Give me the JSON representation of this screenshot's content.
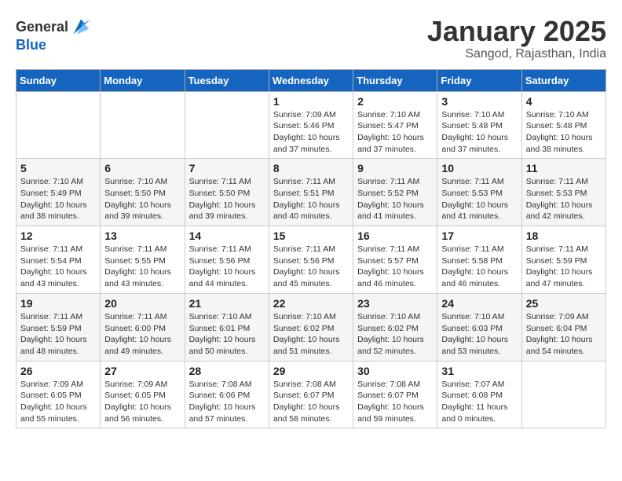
{
  "header": {
    "logo_general": "General",
    "logo_blue": "Blue",
    "month": "January 2025",
    "location": "Sangod, Rajasthan, India"
  },
  "days_of_week": [
    "Sunday",
    "Monday",
    "Tuesday",
    "Wednesday",
    "Thursday",
    "Friday",
    "Saturday"
  ],
  "weeks": [
    [
      {
        "day": "",
        "info": ""
      },
      {
        "day": "",
        "info": ""
      },
      {
        "day": "",
        "info": ""
      },
      {
        "day": "1",
        "info": "Sunrise: 7:09 AM\nSunset: 5:46 PM\nDaylight: 10 hours\nand 37 minutes."
      },
      {
        "day": "2",
        "info": "Sunrise: 7:10 AM\nSunset: 5:47 PM\nDaylight: 10 hours\nand 37 minutes."
      },
      {
        "day": "3",
        "info": "Sunrise: 7:10 AM\nSunset: 5:48 PM\nDaylight: 10 hours\nand 37 minutes."
      },
      {
        "day": "4",
        "info": "Sunrise: 7:10 AM\nSunset: 5:48 PM\nDaylight: 10 hours\nand 38 minutes."
      }
    ],
    [
      {
        "day": "5",
        "info": "Sunrise: 7:10 AM\nSunset: 5:49 PM\nDaylight: 10 hours\nand 38 minutes."
      },
      {
        "day": "6",
        "info": "Sunrise: 7:10 AM\nSunset: 5:50 PM\nDaylight: 10 hours\nand 39 minutes."
      },
      {
        "day": "7",
        "info": "Sunrise: 7:11 AM\nSunset: 5:50 PM\nDaylight: 10 hours\nand 39 minutes."
      },
      {
        "day": "8",
        "info": "Sunrise: 7:11 AM\nSunset: 5:51 PM\nDaylight: 10 hours\nand 40 minutes."
      },
      {
        "day": "9",
        "info": "Sunrise: 7:11 AM\nSunset: 5:52 PM\nDaylight: 10 hours\nand 41 minutes."
      },
      {
        "day": "10",
        "info": "Sunrise: 7:11 AM\nSunset: 5:53 PM\nDaylight: 10 hours\nand 41 minutes."
      },
      {
        "day": "11",
        "info": "Sunrise: 7:11 AM\nSunset: 5:53 PM\nDaylight: 10 hours\nand 42 minutes."
      }
    ],
    [
      {
        "day": "12",
        "info": "Sunrise: 7:11 AM\nSunset: 5:54 PM\nDaylight: 10 hours\nand 43 minutes."
      },
      {
        "day": "13",
        "info": "Sunrise: 7:11 AM\nSunset: 5:55 PM\nDaylight: 10 hours\nand 43 minutes."
      },
      {
        "day": "14",
        "info": "Sunrise: 7:11 AM\nSunset: 5:56 PM\nDaylight: 10 hours\nand 44 minutes."
      },
      {
        "day": "15",
        "info": "Sunrise: 7:11 AM\nSunset: 5:56 PM\nDaylight: 10 hours\nand 45 minutes."
      },
      {
        "day": "16",
        "info": "Sunrise: 7:11 AM\nSunset: 5:57 PM\nDaylight: 10 hours\nand 46 minutes."
      },
      {
        "day": "17",
        "info": "Sunrise: 7:11 AM\nSunset: 5:58 PM\nDaylight: 10 hours\nand 46 minutes."
      },
      {
        "day": "18",
        "info": "Sunrise: 7:11 AM\nSunset: 5:59 PM\nDaylight: 10 hours\nand 47 minutes."
      }
    ],
    [
      {
        "day": "19",
        "info": "Sunrise: 7:11 AM\nSunset: 5:59 PM\nDaylight: 10 hours\nand 48 minutes."
      },
      {
        "day": "20",
        "info": "Sunrise: 7:11 AM\nSunset: 6:00 PM\nDaylight: 10 hours\nand 49 minutes."
      },
      {
        "day": "21",
        "info": "Sunrise: 7:10 AM\nSunset: 6:01 PM\nDaylight: 10 hours\nand 50 minutes."
      },
      {
        "day": "22",
        "info": "Sunrise: 7:10 AM\nSunset: 6:02 PM\nDaylight: 10 hours\nand 51 minutes."
      },
      {
        "day": "23",
        "info": "Sunrise: 7:10 AM\nSunset: 6:02 PM\nDaylight: 10 hours\nand 52 minutes."
      },
      {
        "day": "24",
        "info": "Sunrise: 7:10 AM\nSunset: 6:03 PM\nDaylight: 10 hours\nand 53 minutes."
      },
      {
        "day": "25",
        "info": "Sunrise: 7:09 AM\nSunset: 6:04 PM\nDaylight: 10 hours\nand 54 minutes."
      }
    ],
    [
      {
        "day": "26",
        "info": "Sunrise: 7:09 AM\nSunset: 6:05 PM\nDaylight: 10 hours\nand 55 minutes."
      },
      {
        "day": "27",
        "info": "Sunrise: 7:09 AM\nSunset: 6:05 PM\nDaylight: 10 hours\nand 56 minutes."
      },
      {
        "day": "28",
        "info": "Sunrise: 7:08 AM\nSunset: 6:06 PM\nDaylight: 10 hours\nand 57 minutes."
      },
      {
        "day": "29",
        "info": "Sunrise: 7:08 AM\nSunset: 6:07 PM\nDaylight: 10 hours\nand 58 minutes."
      },
      {
        "day": "30",
        "info": "Sunrise: 7:08 AM\nSunset: 6:07 PM\nDaylight: 10 hours\nand 59 minutes."
      },
      {
        "day": "31",
        "info": "Sunrise: 7:07 AM\nSunset: 6:08 PM\nDaylight: 11 hours\nand 0 minutes."
      },
      {
        "day": "",
        "info": ""
      }
    ]
  ]
}
